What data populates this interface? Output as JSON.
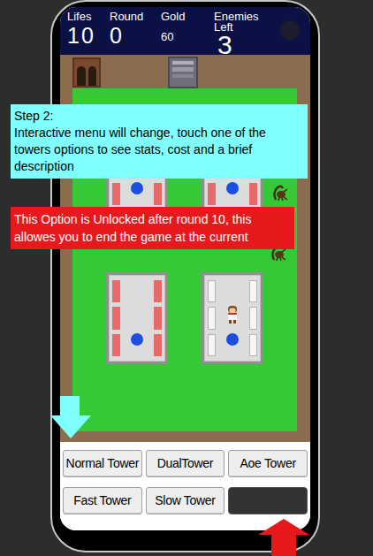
{
  "hud": {
    "stats": [
      {
        "label": "Lifes",
        "value": "10",
        "kind": "large"
      },
      {
        "label": "Round",
        "value": "0",
        "kind": "large"
      },
      {
        "label": "Gold",
        "value": "60",
        "kind": "small"
      },
      {
        "label": "Enemies Left",
        "value": "3",
        "kind": "huge"
      }
    ]
  },
  "map": {
    "towers": [
      {
        "has_unit": false
      },
      {
        "has_unit": false
      },
      {
        "has_unit": false
      },
      {
        "has_unit": true
      }
    ]
  },
  "tutorial": {
    "title": "Step 2:",
    "body": "Interactive menu will change, touch one of the towers options to see stats, cost and a brief description"
  },
  "notice": {
    "text": "This Option is Unlocked after round 10, this allowes you to end the game at the current"
  },
  "menu": {
    "buttons": [
      {
        "label": "Normal Tower",
        "disabled": false
      },
      {
        "label": "DualTower",
        "disabled": false
      },
      {
        "label": "Aoe Tower",
        "disabled": false
      },
      {
        "label": "Fast Tower",
        "disabled": false
      },
      {
        "label": "Slow Tower",
        "disabled": false
      },
      {
        "disabled": true
      }
    ]
  }
}
